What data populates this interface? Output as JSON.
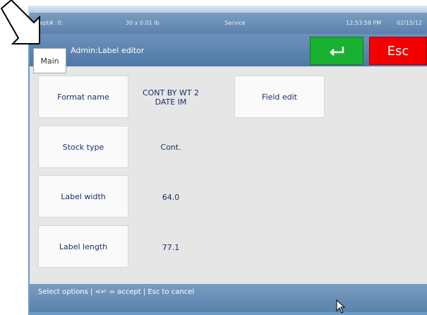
{
  "status": {
    "dept": "Dept#: 0:",
    "capacity": "30 x 0.01 lb",
    "mode": "Service",
    "time": "12:53:58 PM",
    "date": "02/15/12"
  },
  "header": {
    "main_label": "Main",
    "title": "Admin:Label editor",
    "esc_label": "Esc"
  },
  "fields": [
    {
      "label": "Format name",
      "value_line1": "CONT BY WT 2",
      "value_line2": "DATE IM"
    },
    {
      "label": "Stock type",
      "value_line1": "Cont.",
      "value_line2": ""
    },
    {
      "label": "Label width",
      "value_line1": "64.0",
      "value_line2": ""
    },
    {
      "label": "Label length",
      "value_line1": "77.1",
      "value_line2": ""
    }
  ],
  "actions": {
    "field_edit": "Field edit"
  },
  "help": {
    "text": "Select options | <↵ = accept | Esc to cancel"
  },
  "colors": {
    "enter": "#19b132",
    "esc": "#f20000",
    "tile_text": "#18306a"
  },
  "icons": {
    "enter": "enter-arrow-icon",
    "pointer": "pointer-arrow-icon",
    "cursor": "mouse-cursor-icon"
  }
}
